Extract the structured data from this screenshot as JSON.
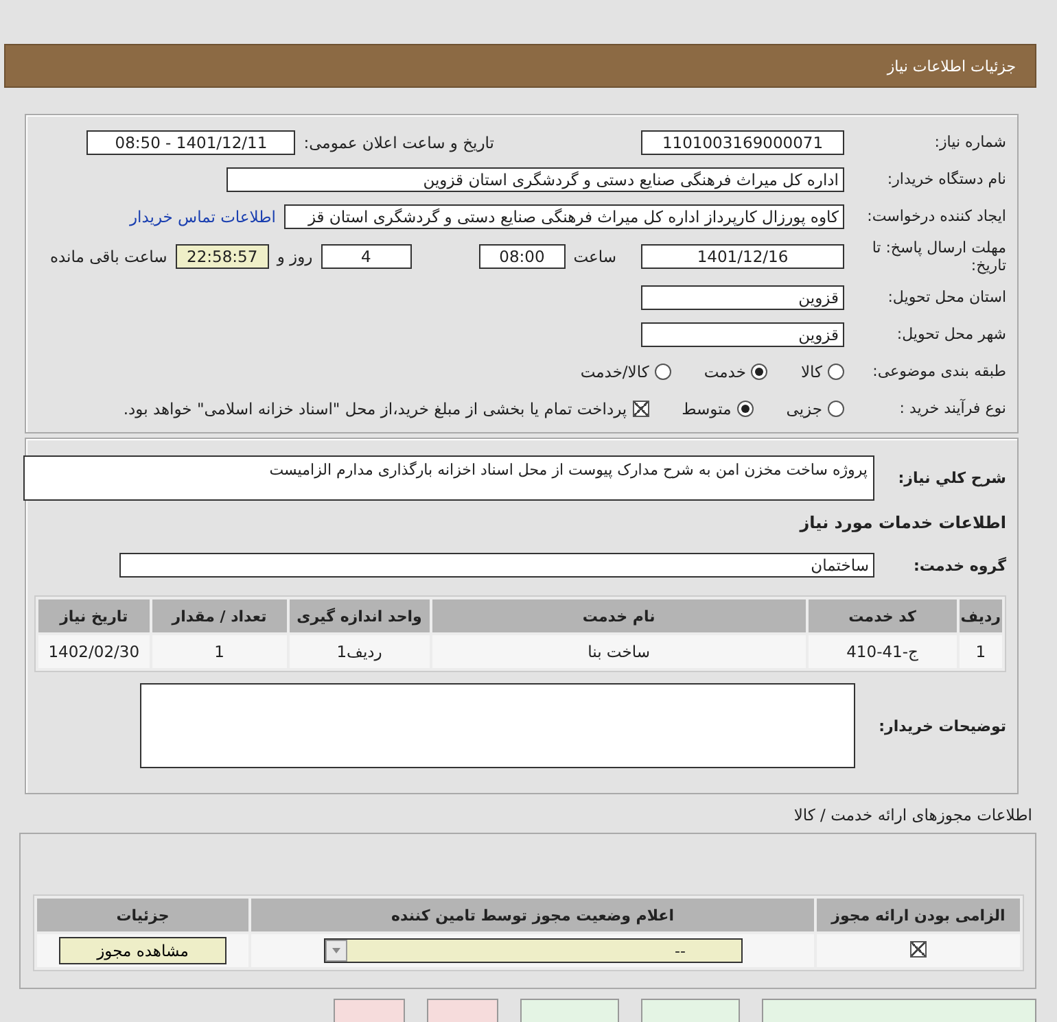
{
  "header": {
    "title": "جزئیات اطلاعات نیاز"
  },
  "details": {
    "need_number": {
      "label": "شماره نیاز:",
      "value": "1101003169000071"
    },
    "announce": {
      "label": "تاریخ و ساعت اعلان عمومی:",
      "value": "1401/12/11 - 08:50"
    },
    "buyer": {
      "label": "نام دستگاه خریدار:",
      "value": "اداره کل میراث فرهنگی  صنایع دستی و گردشگری استان قزوین"
    },
    "creator": {
      "label": "ایجاد کننده درخواست:",
      "value": "کاوه پورزال کارپرداز اداره کل میراث فرهنگی  صنایع دستی و گردشگری استان قز",
      "link": "اطلاعات تماس خریدار"
    },
    "deadline": {
      "label": "مهلت ارسال پاسخ: تا تاریخ:",
      "date": "1401/12/16",
      "time_label": "ساعت",
      "time": "08:00",
      "days": "4",
      "days_label": "روز و",
      "remaining": "22:58:57",
      "remaining_label": "ساعت باقی مانده"
    },
    "province": {
      "label": "استان محل تحویل:",
      "value": "قزوین"
    },
    "city": {
      "label": "شهر محل تحویل:",
      "value": "قزوین"
    },
    "category": {
      "label": "طبقه بندی موضوعی:",
      "options": [
        {
          "label": "کالا",
          "selected": false
        },
        {
          "label": "خدمت",
          "selected": true
        },
        {
          "label": "کالا/خدمت",
          "selected": false
        }
      ]
    },
    "process": {
      "label": "نوع فرآیند خرید :",
      "options": [
        {
          "label": "جزیی",
          "selected": false
        },
        {
          "label": "متوسط",
          "selected": true
        }
      ],
      "payment": {
        "checked": true,
        "text": "پرداخت تمام یا بخشی از مبلغ خرید،از محل \"اسناد خزانه اسلامی\" خواهد بود."
      }
    }
  },
  "needs": {
    "summary": {
      "label": "شرح کلي نياز:",
      "value": "پروژه ساخت مخزن امن  به شرح مدارک پیوست از محل اسناد اخزانه بارگذاری مدارم الزامیست"
    },
    "services_title": "اطلاعات خدمات مورد نیاز",
    "service_group": {
      "label": "گروه خدمت:",
      "value": "ساختمان"
    },
    "table": {
      "columns": [
        "ردیف",
        "کد خدمت",
        "نام خدمت",
        "واحد اندازه گیری",
        "تعداد / مقدار",
        "تاریخ نیاز"
      ],
      "rows": [
        [
          "1",
          "ج-41-410",
          "ساخت بنا",
          "ردیف1",
          "1",
          "1402/02/30"
        ]
      ]
    },
    "buyer_notes": {
      "label": "توضیحات خریدار:"
    }
  },
  "permits": {
    "title": "اطلاعات مجوزهای ارائه خدمت / کالا",
    "table": {
      "columns": [
        "الزامی بودن ارائه مجوز",
        "اعلام وضعیت مجوز توسط تامین کننده",
        "جزئیات"
      ],
      "rows": [
        {
          "required": true,
          "status": "--",
          "action": "مشاهده مجوز"
        }
      ]
    }
  },
  "bottom_buttons": [
    {
      "kind": "primary"
    },
    {
      "kind": "primary"
    },
    {
      "kind": "primary"
    },
    {
      "kind": "danger"
    },
    {
      "kind": "danger"
    }
  ]
}
